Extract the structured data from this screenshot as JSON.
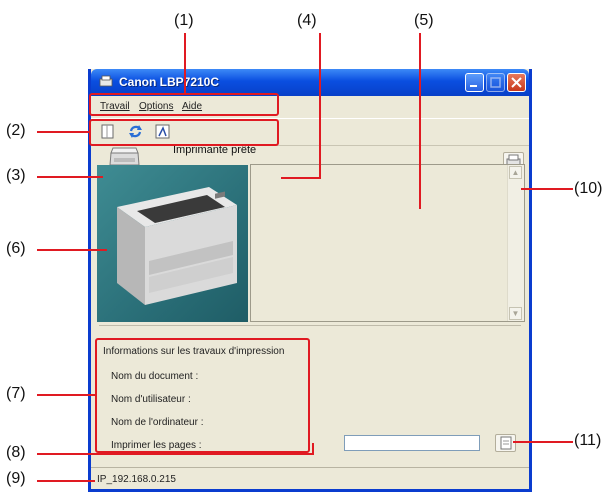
{
  "window": {
    "title": "Canon LBP7210C"
  },
  "menu": {
    "items": [
      "Travail",
      "Options",
      "Aide"
    ]
  },
  "toolbar": {
    "icons": [
      "document-icon",
      "refresh-icon",
      "printer-settings-icon"
    ]
  },
  "status": {
    "message": "Imprimante prête"
  },
  "job_info": {
    "title": "Informations sur les travaux d'impression",
    "document_label": "Nom du document :",
    "user_label": "Nom d'utilisateur :",
    "computer_label": "Nom de l'ordinateur :",
    "pages_label": "Imprimer les pages :",
    "pages_value": ""
  },
  "statusbar": {
    "address": "IP_192.168.0.215"
  },
  "callouts": {
    "c1": "(1)",
    "c2": "(2)",
    "c3": "(3)",
    "c4": "(4)",
    "c5": "(5)",
    "c6": "(6)",
    "c7": "(7)",
    "c8": "(8)",
    "c9": "(9)",
    "c10": "(10)",
    "c11": "(11)"
  },
  "colors": {
    "callout_red": "#e01a22",
    "title_blue": "#0a4ee0",
    "window_bg": "#ece9d8"
  }
}
